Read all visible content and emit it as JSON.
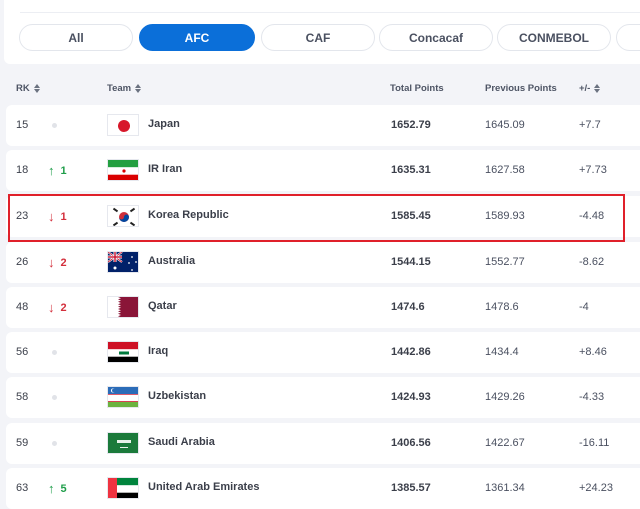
{
  "filters": {
    "items": [
      {
        "label": "All",
        "active": false
      },
      {
        "label": "AFC",
        "active": true
      },
      {
        "label": "CAF",
        "active": false
      },
      {
        "label": "Concacaf",
        "active": false
      },
      {
        "label": "CONMEBOL",
        "active": false
      },
      {
        "label": "",
        "active": false
      }
    ]
  },
  "table": {
    "headers": {
      "rank": "RK",
      "team": "Team",
      "total_points": "Total Points",
      "previous_points": "Previous Points",
      "diff": "+/-"
    },
    "rows": [
      {
        "rank": "15",
        "movement": "none",
        "change": "",
        "team": "Japan",
        "flag": "japan-flag",
        "total": "1652.79",
        "previous": "1645.09",
        "diff": "+7.7"
      },
      {
        "rank": "18",
        "movement": "up",
        "change": "1",
        "team": "IR Iran",
        "flag": "iran-flag",
        "total": "1635.31",
        "previous": "1627.58",
        "diff": "+7.73"
      },
      {
        "rank": "23",
        "movement": "down",
        "change": "1",
        "team": "Korea Republic",
        "flag": "korea-flag",
        "total": "1585.45",
        "previous": "1589.93",
        "diff": "-4.48",
        "highlighted": true
      },
      {
        "rank": "26",
        "movement": "down",
        "change": "2",
        "team": "Australia",
        "flag": "australia-flag",
        "total": "1544.15",
        "previous": "1552.77",
        "diff": "-8.62"
      },
      {
        "rank": "48",
        "movement": "down",
        "change": "2",
        "team": "Qatar",
        "flag": "qatar-flag",
        "total": "1474.6",
        "previous": "1478.6",
        "diff": "-4"
      },
      {
        "rank": "56",
        "movement": "none",
        "change": "",
        "team": "Iraq",
        "flag": "iraq-flag",
        "total": "1442.86",
        "previous": "1434.4",
        "diff": "+8.46"
      },
      {
        "rank": "58",
        "movement": "none",
        "change": "",
        "team": "Uzbekistan",
        "flag": "uzbekistan-flag",
        "total": "1424.93",
        "previous": "1429.26",
        "diff": "-4.33"
      },
      {
        "rank": "59",
        "movement": "none",
        "change": "",
        "team": "Saudi Arabia",
        "flag": "saudi-arabia-flag",
        "total": "1406.56",
        "previous": "1422.67",
        "diff": "-16.11"
      },
      {
        "rank": "63",
        "movement": "up",
        "change": "5",
        "team": "United Arab Emirates",
        "flag": "uae-flag",
        "total": "1385.57",
        "previous": "1361.34",
        "diff": "+24.23"
      }
    ]
  },
  "colors": {
    "accent": "#0b6fd9",
    "up": "#1f9e4a",
    "down": "#d32f3c",
    "highlight_border": "#e0202a"
  }
}
